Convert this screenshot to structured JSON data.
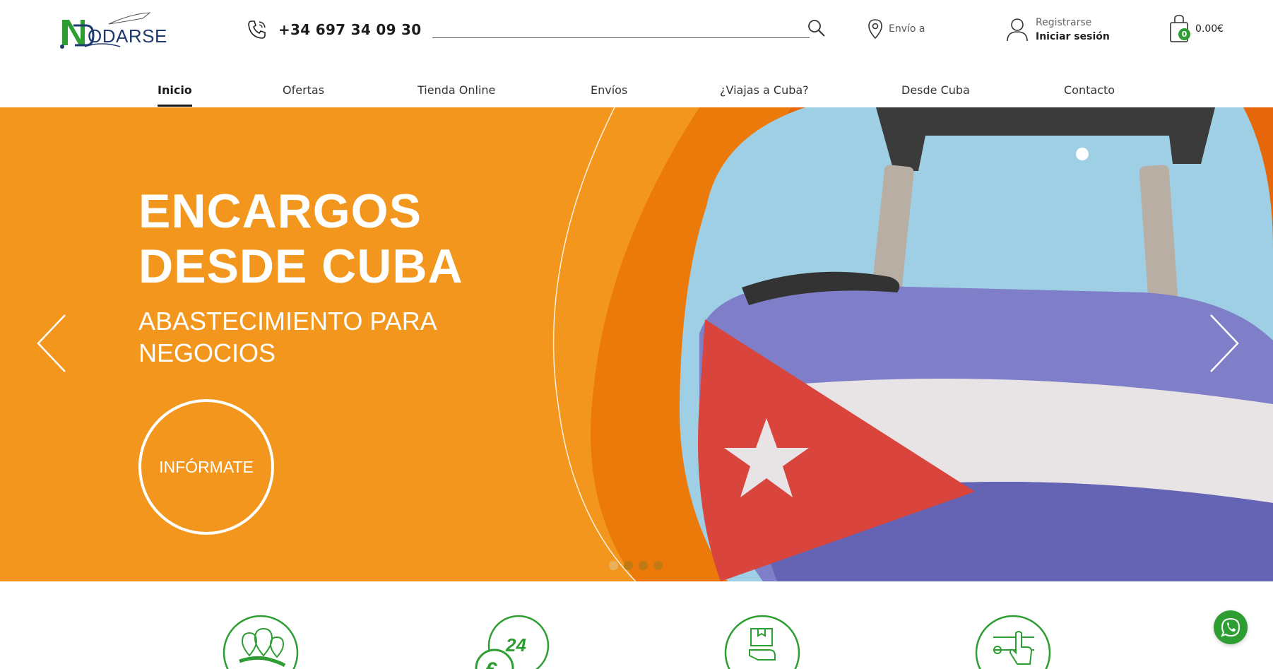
{
  "header": {
    "logo_text": "NODARSE",
    "phone": "+34 697 34 09 30",
    "search_placeholder": "",
    "ship_label": "Envío a",
    "account_register": "Registrarse",
    "account_login": "Iniciar sesión",
    "cart_count": "0",
    "cart_total": "0.00€"
  },
  "nav": {
    "items": [
      {
        "label": "Inicio",
        "active": true
      },
      {
        "label": "Ofertas"
      },
      {
        "label": "Tienda Online"
      },
      {
        "label": "Envíos"
      },
      {
        "label": "¿Viajas a Cuba?"
      },
      {
        "label": "Desde Cuba"
      },
      {
        "label": "Contacto"
      }
    ]
  },
  "hero": {
    "title": "ENCARGOS DESDE CUBA",
    "subtitle": "ABASTECIMIENTO PARA NEGOCIOS",
    "cta": "INFÓRMATE",
    "slide_count": 4,
    "active_slide": 1
  },
  "features": {
    "icons": [
      "cuba-map-pins-icon",
      "24h-euro-icon",
      "package-delivery-icon",
      "touch-select-icon"
    ]
  },
  "colors": {
    "brand_orange": "#f3961d",
    "dark_orange": "#ec7a0b",
    "brand_green": "#2e9e33",
    "navy": "#1f3a6e"
  }
}
